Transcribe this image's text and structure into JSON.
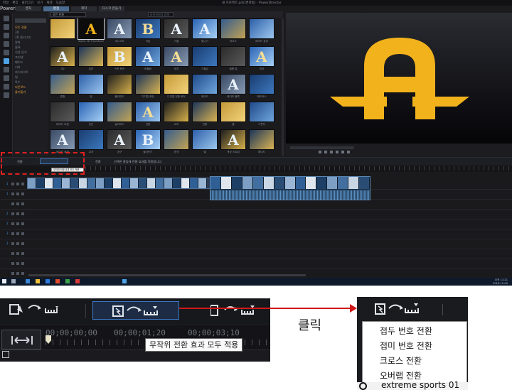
{
  "window": {
    "doc_title": "새 프로젝트.pds(변경됨) - PowerDirector",
    "brand": "PowerDirector",
    "menu": [
      "파일",
      "편집",
      "플러그인",
      "보기",
      "재생",
      "도움말"
    ],
    "mode_tabs": [
      "캡처",
      "편집",
      "제작",
      "디스크 만들기"
    ],
    "library_filter": "모든 전환",
    "library_search_placeholder": "라이브러리 검색"
  },
  "tree": {
    "items": [
      "모든 전환",
      "3D",
      "3D 플러그인",
      "알파",
      "블록",
      "가장 인기",
      "프리셋",
      "페이드",
      "기하",
      "하이라이트",
      "빛",
      "특수",
      "다운로드",
      "즐겨찾기"
    ],
    "highlighted": [
      0,
      12,
      13
    ]
  },
  "library": {
    "captions": [
      "",
      "Alpha 3D Transitions",
      "3D 교차",
      "차분",
      "기울",
      "빛나기",
      "마우스",
      "페이드 효과",
      "3D",
      "분리",
      "스핀 렌즈",
      "비틀림",
      "위치",
      "기울임",
      "필름 릴",
      "미러",
      "혼합",
      "빛",
      "블라인드",
      "디지털 회전",
      "디지털 전환 회전",
      "페이드",
      "테이프 블록",
      "매트릭스",
      "페이드 트윈",
      "공간",
      "슬라이드",
      "전환",
      "교차",
      "전환",
      "볼",
      "스펀지",
      "페이드 회색",
      "교차",
      "개구",
      "블라인드",
      "흰색",
      "별",
      "색상 스트립",
      "페이드"
    ],
    "glyphs": [
      "",
      "A",
      "A",
      "B",
      "A",
      "A",
      "",
      "",
      "A",
      "",
      "B",
      "A",
      "A",
      "",
      "",
      "A",
      "",
      "",
      "",
      "",
      "",
      "",
      "A",
      "",
      "",
      "",
      "",
      "A",
      "",
      "",
      "",
      "",
      "A",
      "",
      "A",
      "B",
      "",
      "",
      "A",
      ""
    ]
  },
  "toolbar": {
    "mini_labels": [
      "전환",
      "전환",
      "선택한 클립에 전환 효과를 적용합니다"
    ]
  },
  "mini_tooltip": "무작위 전환 효과 모두 적용",
  "tracks": {
    "labels": [
      "1",
      "1",
      "",
      "2",
      "2",
      "3",
      "3",
      "",
      "",
      ""
    ]
  },
  "taskbar": {
    "time": "오전 11:21",
    "date": "2018-12-09"
  },
  "zoom1": {
    "timecodes": [
      "00;00;00;00",
      "00;00;01;20",
      "00;00;03;10"
    ],
    "tooltip": "무작위 전환 효과 모두 적용"
  },
  "annotation": {
    "click_label": "클릭"
  },
  "zoom2": {
    "menu_items": [
      "접두 번호 전환",
      "접미 번호 전환",
      "크로스 전환",
      "오버랩 전환"
    ],
    "clip_name": "extreme sports 01"
  },
  "colors": {
    "accent": "#3b78c4",
    "logo_gold": "#f2b21c",
    "annotation_red": "#d01818"
  }
}
